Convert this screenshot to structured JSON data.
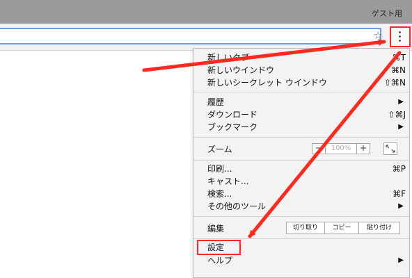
{
  "title_bar": {
    "guest_label": "ゲスト用"
  },
  "toolbar": {
    "star_icon": "star-icon",
    "menu_icon": "more-vertical-icon"
  },
  "menu": {
    "items": [
      {
        "label": "新しいタブ",
        "shortcut": "⌘T"
      },
      {
        "label": "新しいウインドウ",
        "shortcut": "⌘N"
      },
      {
        "label": "新しいシークレット ウインドウ",
        "shortcut": "⇧⌘N"
      },
      {
        "label": "履歴",
        "shortcut": "▶"
      },
      {
        "label": "ダウンロード",
        "shortcut": "⇧⌘J"
      },
      {
        "label": "ブックマーク",
        "shortcut": "▶"
      },
      {
        "label": "印刷...",
        "shortcut": "⌘P"
      },
      {
        "label": "キャスト...",
        "shortcut": ""
      },
      {
        "label": "検索...",
        "shortcut": "⌘F"
      },
      {
        "label": "その他のツール",
        "shortcut": "▶"
      },
      {
        "label": "設定",
        "shortcut": ""
      },
      {
        "label": "ヘルプ",
        "shortcut": "▶"
      }
    ],
    "zoom": {
      "label": "ズーム",
      "minus": "−",
      "value": "100%",
      "plus": "+"
    },
    "edit": {
      "label": "編集",
      "cut": "切り取り",
      "copy": "コピー",
      "paste": "貼り付け"
    }
  },
  "annotation_color": "#ff2a1f"
}
